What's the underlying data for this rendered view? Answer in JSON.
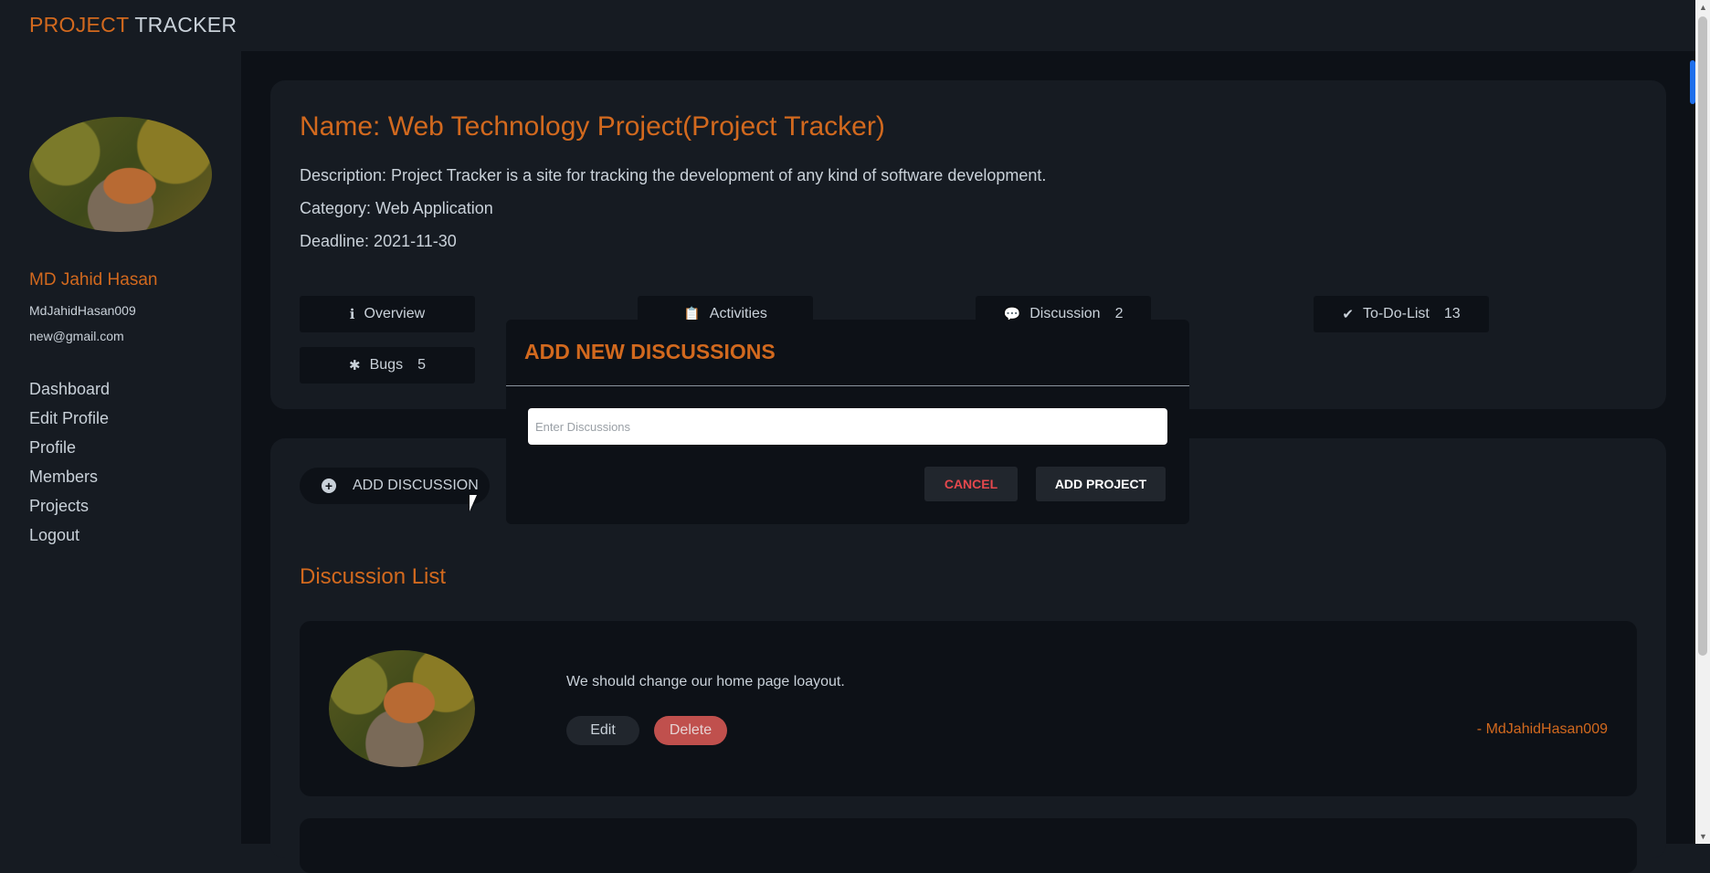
{
  "brand": {
    "part1": "PROJECT",
    "part2": "TRACKER"
  },
  "user": {
    "name": "MD Jahid Hasan",
    "handle": "MdJahidHasan009",
    "email": "new@gmail.com"
  },
  "nav": [
    "Dashboard",
    "Edit Profile",
    "Profile",
    "Members",
    "Projects",
    "Logout"
  ],
  "project": {
    "title": "Name: Web Technology Project(Project Tracker)",
    "description": "Description: Project Tracker is a site for tracking the development of any kind of software development.",
    "category": "Category: Web Application",
    "deadline": "Deadline: 2021-11-30"
  },
  "tabs": {
    "overview": {
      "label": "Overview"
    },
    "activities": {
      "label": "Activities"
    },
    "discussion": {
      "label": "Discussion",
      "count": "2"
    },
    "todo": {
      "label": "To-Do-List",
      "count": "13"
    },
    "bugs": {
      "label": "Bugs",
      "count": "5"
    }
  },
  "discussions": {
    "add_button": "ADD DISCUSSION",
    "heading": "Discussion List",
    "items": [
      {
        "text": "We should change our home page loayout.",
        "author": "- MdJahidHasan009",
        "edit": "Edit",
        "delete": "Delete"
      }
    ]
  },
  "modal": {
    "title": "ADD NEW DISCUSSIONS",
    "placeholder": "Enter Discussions",
    "cancel": "CANCEL",
    "submit": "ADD PROJECT"
  },
  "colors": {
    "accent": "#d2691e",
    "danger": "#e5484d",
    "delete_bg": "#c0504d"
  }
}
